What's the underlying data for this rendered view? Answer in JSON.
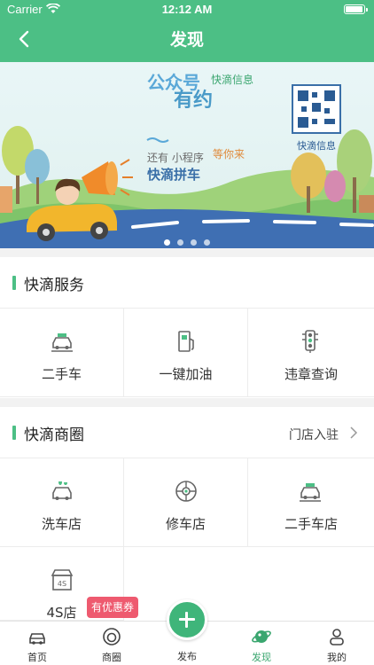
{
  "status": {
    "carrier": "Carrier",
    "time": "12:12 AM"
  },
  "nav": {
    "title": "发现"
  },
  "banner": {
    "line1": "公众号",
    "line2": "有约",
    "vertical": "快滴信息",
    "small1": "还有 小程序",
    "small2": "快滴拼车",
    "waiting": "等你来",
    "qr_label": "快滴信息",
    "page_count": 4,
    "active_page": 1
  },
  "services": {
    "title": "快滴服务",
    "items": [
      {
        "label": "二手车",
        "icon": "used-car-icon"
      },
      {
        "label": "一键加油",
        "icon": "gas-pump-icon"
      },
      {
        "label": "违章查询",
        "icon": "traffic-light-icon"
      }
    ]
  },
  "shops": {
    "title": "快滴商圈",
    "more": "门店入驻",
    "items": [
      {
        "label": "洗车店",
        "icon": "car-wash-icon"
      },
      {
        "label": "修车店",
        "icon": "repair-icon"
      },
      {
        "label": "二手车店",
        "icon": "used-car-icon"
      },
      {
        "label": "4S店",
        "icon": "4s-store-icon"
      }
    ],
    "badge": "有优惠券"
  },
  "tabs": [
    {
      "label": "首页",
      "icon": "home-car-icon"
    },
    {
      "label": "商圈",
      "icon": "circle-icon"
    },
    {
      "label": "发布",
      "icon": "plus-icon"
    },
    {
      "label": "发现",
      "icon": "planet-icon",
      "active": true
    },
    {
      "label": "我的",
      "icon": "profile-icon"
    }
  ],
  "colors": {
    "brand": "#4cbf85",
    "badge": "#ee5a6f"
  }
}
